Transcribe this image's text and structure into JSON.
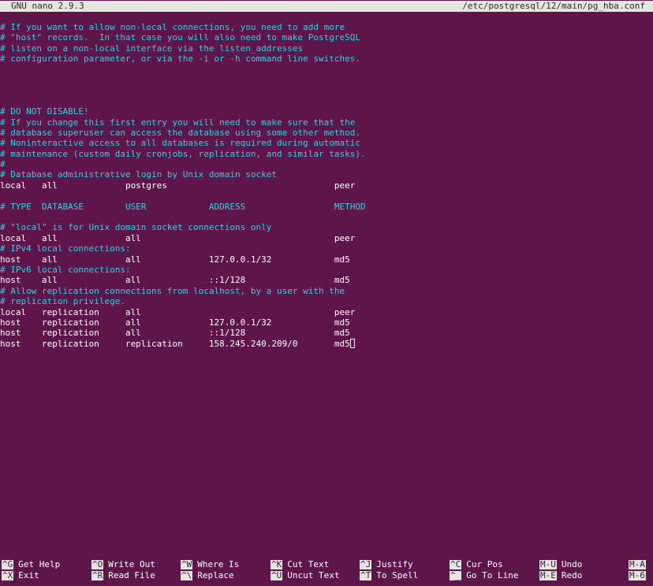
{
  "titlebar": {
    "app": "GNU nano 2.9.3",
    "file": "/etc/postgresql/12/main/pg_hba.conf"
  },
  "editor": {
    "lines": [
      {
        "text": "# If you want to allow non-local connections, you need to add more",
        "type": "comment"
      },
      {
        "text": "# \"host\" records.  In that case you will also need to make PostgreSQL",
        "type": "comment"
      },
      {
        "text": "# listen on a non-local interface via the listen_addresses",
        "type": "comment"
      },
      {
        "text": "# configuration parameter, or via the -i or -h command line switches.",
        "type": "comment"
      },
      {
        "text": "",
        "type": "blank"
      },
      {
        "text": "",
        "type": "blank"
      },
      {
        "text": "",
        "type": "blank"
      },
      {
        "text": "",
        "type": "blank"
      },
      {
        "text": "# DO NOT DISABLE!",
        "type": "comment"
      },
      {
        "text": "# If you change this first entry you will need to make sure that the",
        "type": "comment"
      },
      {
        "text": "# database superuser can access the database using some other method.",
        "type": "comment"
      },
      {
        "text": "# Noninteractive access to all databases is required during automatic",
        "type": "comment"
      },
      {
        "text": "# maintenance (custom daily cronjobs, replication, and similar tasks).",
        "type": "comment"
      },
      {
        "text": "#",
        "type": "comment"
      },
      {
        "text": "# Database administrative login by Unix domain socket",
        "type": "comment"
      },
      {
        "text": "local   all             postgres                                peer",
        "type": "code"
      },
      {
        "text": "",
        "type": "blank"
      },
      {
        "text": "# TYPE  DATABASE        USER            ADDRESS                 METHOD",
        "type": "comment"
      },
      {
        "text": "",
        "type": "blank"
      },
      {
        "text": "# \"local\" is for Unix domain socket connections only",
        "type": "comment"
      },
      {
        "text": "local   all             all                                     peer",
        "type": "code"
      },
      {
        "text": "# IPv4 local connections:",
        "type": "comment"
      },
      {
        "text": "host    all             all             127.0.0.1/32            md5",
        "type": "code"
      },
      {
        "text": "# IPv6 local connections:",
        "type": "comment"
      },
      {
        "text": "host    all             all             ::1/128                 md5",
        "type": "code"
      },
      {
        "text": "# Allow replication connections from localhost, by a user with the",
        "type": "comment"
      },
      {
        "text": "# replication privilege.",
        "type": "comment"
      },
      {
        "text": "local   replication     all                                     peer",
        "type": "code"
      },
      {
        "text": "host    replication     all             127.0.0.1/32            md5",
        "type": "code"
      },
      {
        "text": "host    replication     all             ::1/128                 md5",
        "type": "code"
      },
      {
        "text": "host    replication     replication     158.245.240.209/0       md5",
        "type": "code",
        "cursor": true
      }
    ]
  },
  "shortcuts": [
    [
      {
        "key": "^G",
        "label": "Get Help"
      },
      {
        "key": "^O",
        "label": "Write Out"
      },
      {
        "key": "^W",
        "label": "Where Is"
      },
      {
        "key": "^K",
        "label": "Cut Text"
      },
      {
        "key": "^J",
        "label": "Justify"
      },
      {
        "key": "^C",
        "label": "Cur Pos"
      },
      {
        "key": "M-U",
        "label": "Undo"
      },
      {
        "key": "M-A",
        "label": ""
      }
    ],
    [
      {
        "key": "^X",
        "label": "Exit"
      },
      {
        "key": "^R",
        "label": "Read File"
      },
      {
        "key": "^\\",
        "label": "Replace"
      },
      {
        "key": "^U",
        "label": "Uncut Text"
      },
      {
        "key": "^T",
        "label": "To Spell"
      },
      {
        "key": "^_",
        "label": "Go To Line"
      },
      {
        "key": "M-E",
        "label": "Redo"
      },
      {
        "key": "M-6",
        "label": ""
      }
    ]
  ]
}
